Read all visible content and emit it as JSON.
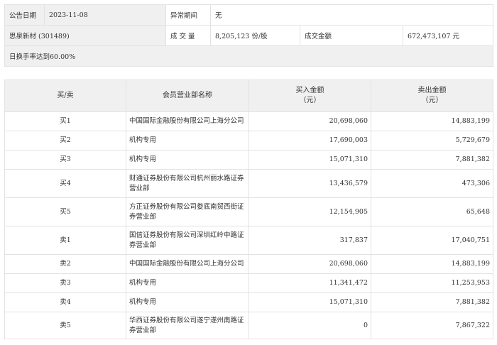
{
  "info": {
    "date_label": "公告日期",
    "date_value": "2023-11-08",
    "period_label": "异常期间",
    "period_value": "无",
    "stock_name": "思泉新材 (301489)",
    "volume_label": "成 交 量",
    "volume_value": "8,205,123 份/股",
    "amount_label": "成交金额",
    "amount_value": "672,473,107 元",
    "reason": "日换手率达到60.00%"
  },
  "deals": {
    "headers": {
      "side": "买/卖",
      "branch": "会员营业部名称",
      "buy": [
        "买入金额",
        "（元）"
      ],
      "sell": [
        "卖出金额",
        "（元）"
      ]
    },
    "rows": [
      {
        "side": "买1",
        "branch": "中国国际金融股份有限公司上海分公司",
        "buy": "20,698,060",
        "sell": "14,883,199"
      },
      {
        "side": "买2",
        "branch": "机构专用",
        "buy": "17,690,003",
        "sell": "5,729,679"
      },
      {
        "side": "买3",
        "branch": "机构专用",
        "buy": "15,071,310",
        "sell": "7,881,382"
      },
      {
        "side": "买4",
        "branch": "财通证券股份有限公司杭州丽水路证券营业部",
        "buy": "13,436,579",
        "sell": "473,306"
      },
      {
        "side": "买5",
        "branch": "方正证券股份有限公司娄底南贸西街证券营业部",
        "buy": "12,154,905",
        "sell": "65,648"
      },
      {
        "side": "卖1",
        "branch": "国信证券股份有限公司深圳红岭中路证券营业部",
        "buy": "317,837",
        "sell": "17,040,751"
      },
      {
        "side": "卖2",
        "branch": "中国国际金融股份有限公司上海分公司",
        "buy": "20,698,060",
        "sell": "14,883,199"
      },
      {
        "side": "卖3",
        "branch": "机构专用",
        "buy": "11,341,472",
        "sell": "11,253,953"
      },
      {
        "side": "卖4",
        "branch": "机构专用",
        "buy": "15,071,310",
        "sell": "7,881,382"
      },
      {
        "side": "卖5",
        "branch": "华西证券股份有限公司遂宁遂州南路证券营业部",
        "buy": "0",
        "sell": "7,867,322"
      }
    ]
  }
}
